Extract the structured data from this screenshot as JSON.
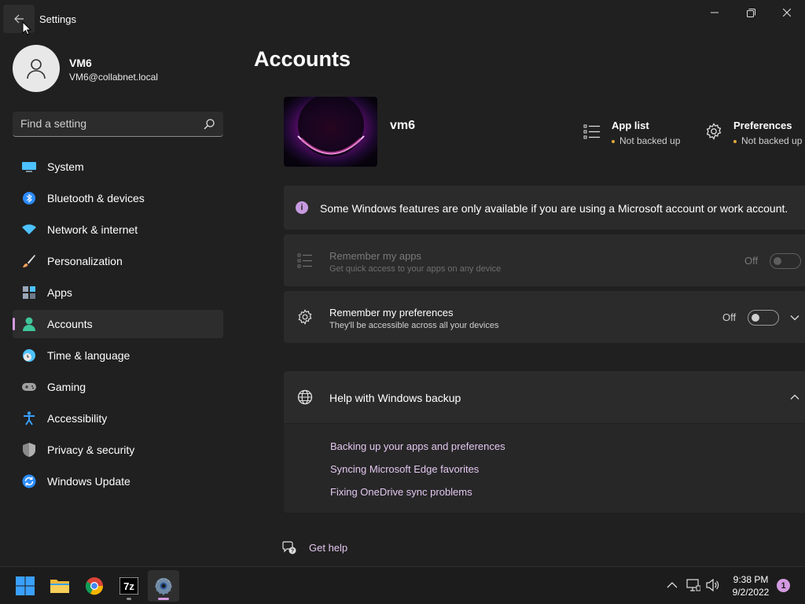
{
  "window": {
    "title": "Settings",
    "back_icon": "back-arrow-icon",
    "controls": [
      "minimize-icon",
      "maximize-icon",
      "close-icon"
    ]
  },
  "user": {
    "name": "VM6",
    "email": "VM6@collabnet.local"
  },
  "search": {
    "placeholder": "Find a setting"
  },
  "sidebar": {
    "items": [
      {
        "label": "System",
        "icon": "system-icon",
        "color": "#4cc2ff"
      },
      {
        "label": "Bluetooth & devices",
        "icon": "bluetooth-icon",
        "color": "#2b8cff"
      },
      {
        "label": "Network & internet",
        "icon": "wifi-icon",
        "color": "#4cc2ff"
      },
      {
        "label": "Personalization",
        "icon": "brush-icon",
        "color": "#f0a15a"
      },
      {
        "label": "Apps",
        "icon": "apps-icon",
        "color": "#9aa7b8"
      },
      {
        "label": "Accounts",
        "icon": "account-icon",
        "color": "#3fc59a",
        "selected": true
      },
      {
        "label": "Time & language",
        "icon": "clock-globe-icon",
        "color": "#4cc2ff"
      },
      {
        "label": "Gaming",
        "icon": "gamepad-icon",
        "color": "#a0a0a0"
      },
      {
        "label": "Accessibility",
        "icon": "accessibility-icon",
        "color": "#3aa0ff"
      },
      {
        "label": "Privacy & security",
        "icon": "shield-icon",
        "color": "#8a8a8a"
      },
      {
        "label": "Windows Update",
        "icon": "update-icon",
        "color": "#2b8cff"
      }
    ]
  },
  "main": {
    "title": "Accounts",
    "device_name": "vm6",
    "backup_status": [
      {
        "title": "App list",
        "status": "Not backed up",
        "icon": "list-icon"
      },
      {
        "title": "Preferences",
        "status": "Not backed up",
        "icon": "gear-icon"
      }
    ],
    "info_message": "Some Windows features are only available if you are using a Microsoft account or work account.",
    "settings": [
      {
        "title": "Remember my apps",
        "subtitle": "Get quick access to your apps on any device",
        "state": "Off",
        "disabled": true,
        "icon": "list-icon"
      },
      {
        "title": "Remember my preferences",
        "subtitle": "They'll be accessible across all your devices",
        "state": "Off",
        "disabled": false,
        "icon": "gear-icon"
      }
    ],
    "help": {
      "title": "Help with Windows backup",
      "icon": "globe-icon",
      "links": [
        "Backing up your apps and preferences",
        "Syncing Microsoft Edge favorites",
        "Fixing OneDrive sync problems"
      ]
    },
    "get_help": "Get help"
  },
  "taskbar": {
    "apps": [
      "start-icon",
      "file-explorer-icon",
      "chrome-icon",
      "7zip-icon",
      "settings-icon"
    ],
    "app_7zip_text": "7z",
    "time": "9:38 PM",
    "date": "9/2/2022",
    "notification_count": "1",
    "accent": "#d39ae0"
  }
}
